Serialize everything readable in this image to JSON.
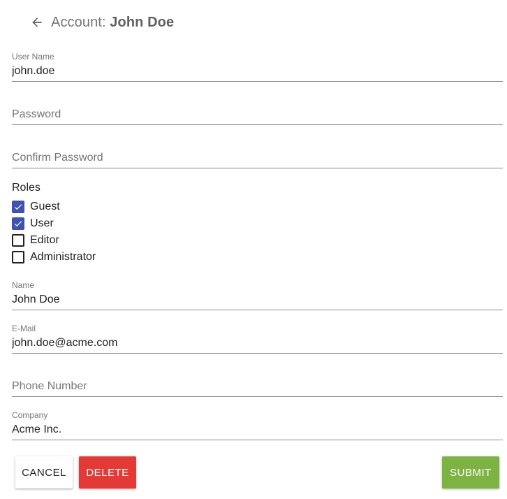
{
  "header": {
    "prefix": "Account:",
    "name": "John Doe"
  },
  "fields": {
    "username": {
      "label": "User Name",
      "value": "john.doe"
    },
    "password": {
      "placeholder": "Password"
    },
    "confirm_password": {
      "placeholder": "Confirm Password"
    },
    "name": {
      "label": "Name",
      "value": "John Doe"
    },
    "email": {
      "label": "E-Mail",
      "value": "john.doe@acme.com"
    },
    "phone": {
      "placeholder": "Phone Number"
    },
    "company": {
      "label": "Company",
      "value": "Acme Inc."
    }
  },
  "roles": {
    "title": "Roles",
    "items": [
      {
        "label": "Guest",
        "checked": true
      },
      {
        "label": "User",
        "checked": true
      },
      {
        "label": "Editor",
        "checked": false
      },
      {
        "label": "Administrator",
        "checked": false
      }
    ]
  },
  "buttons": {
    "cancel": "CANCEL",
    "delete": "DELETE",
    "submit": "SUBMIT"
  },
  "colors": {
    "checkbox_checked": "#3f51b5",
    "delete_button": "#e53935",
    "submit_button": "#7cb342"
  },
  "icons": {
    "back": "arrow-left-icon",
    "check": "check-icon"
  }
}
